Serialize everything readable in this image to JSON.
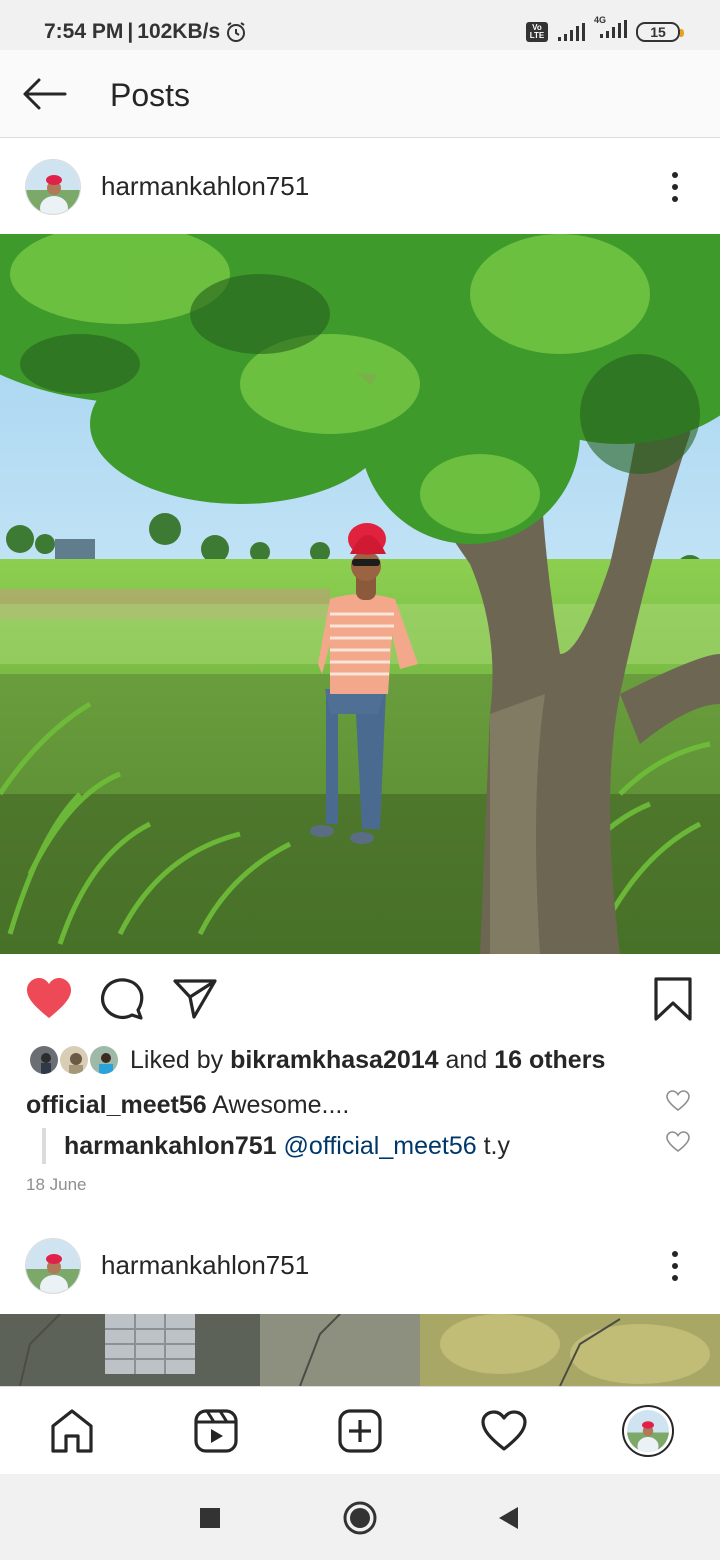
{
  "status_bar": {
    "time": "7:54 PM",
    "speed": "102KB/s",
    "network": "4G",
    "volte": "Vo LTE",
    "battery": "15"
  },
  "app_bar": {
    "title": "Posts"
  },
  "post1": {
    "username": "harmankahlon751",
    "liked_prefix": "Liked by",
    "liked_user": "bikramkhasa2014",
    "liked_and": "and",
    "liked_others": "16 others",
    "comment": {
      "user": "official_meet56",
      "text": "Awesome...."
    },
    "reply": {
      "user": "harmankahlon751",
      "mention": "@official_meet56",
      "text": "t.y"
    },
    "date": "18 June"
  },
  "post2": {
    "username": "harmankahlon751"
  },
  "icons": {
    "back": "arrow-left-icon",
    "more": "more-vertical-icon",
    "like": "heart-filled-icon",
    "comment": "comment-icon",
    "share": "send-icon",
    "save": "bookmark-icon",
    "home": "home-icon",
    "reels": "reels-icon",
    "create": "add-post-icon",
    "activity": "heart-outline-icon"
  },
  "colors": {
    "like": "#ed4956",
    "mention": "#00376b",
    "text": "#262626",
    "muted": "#8e8e8e"
  }
}
